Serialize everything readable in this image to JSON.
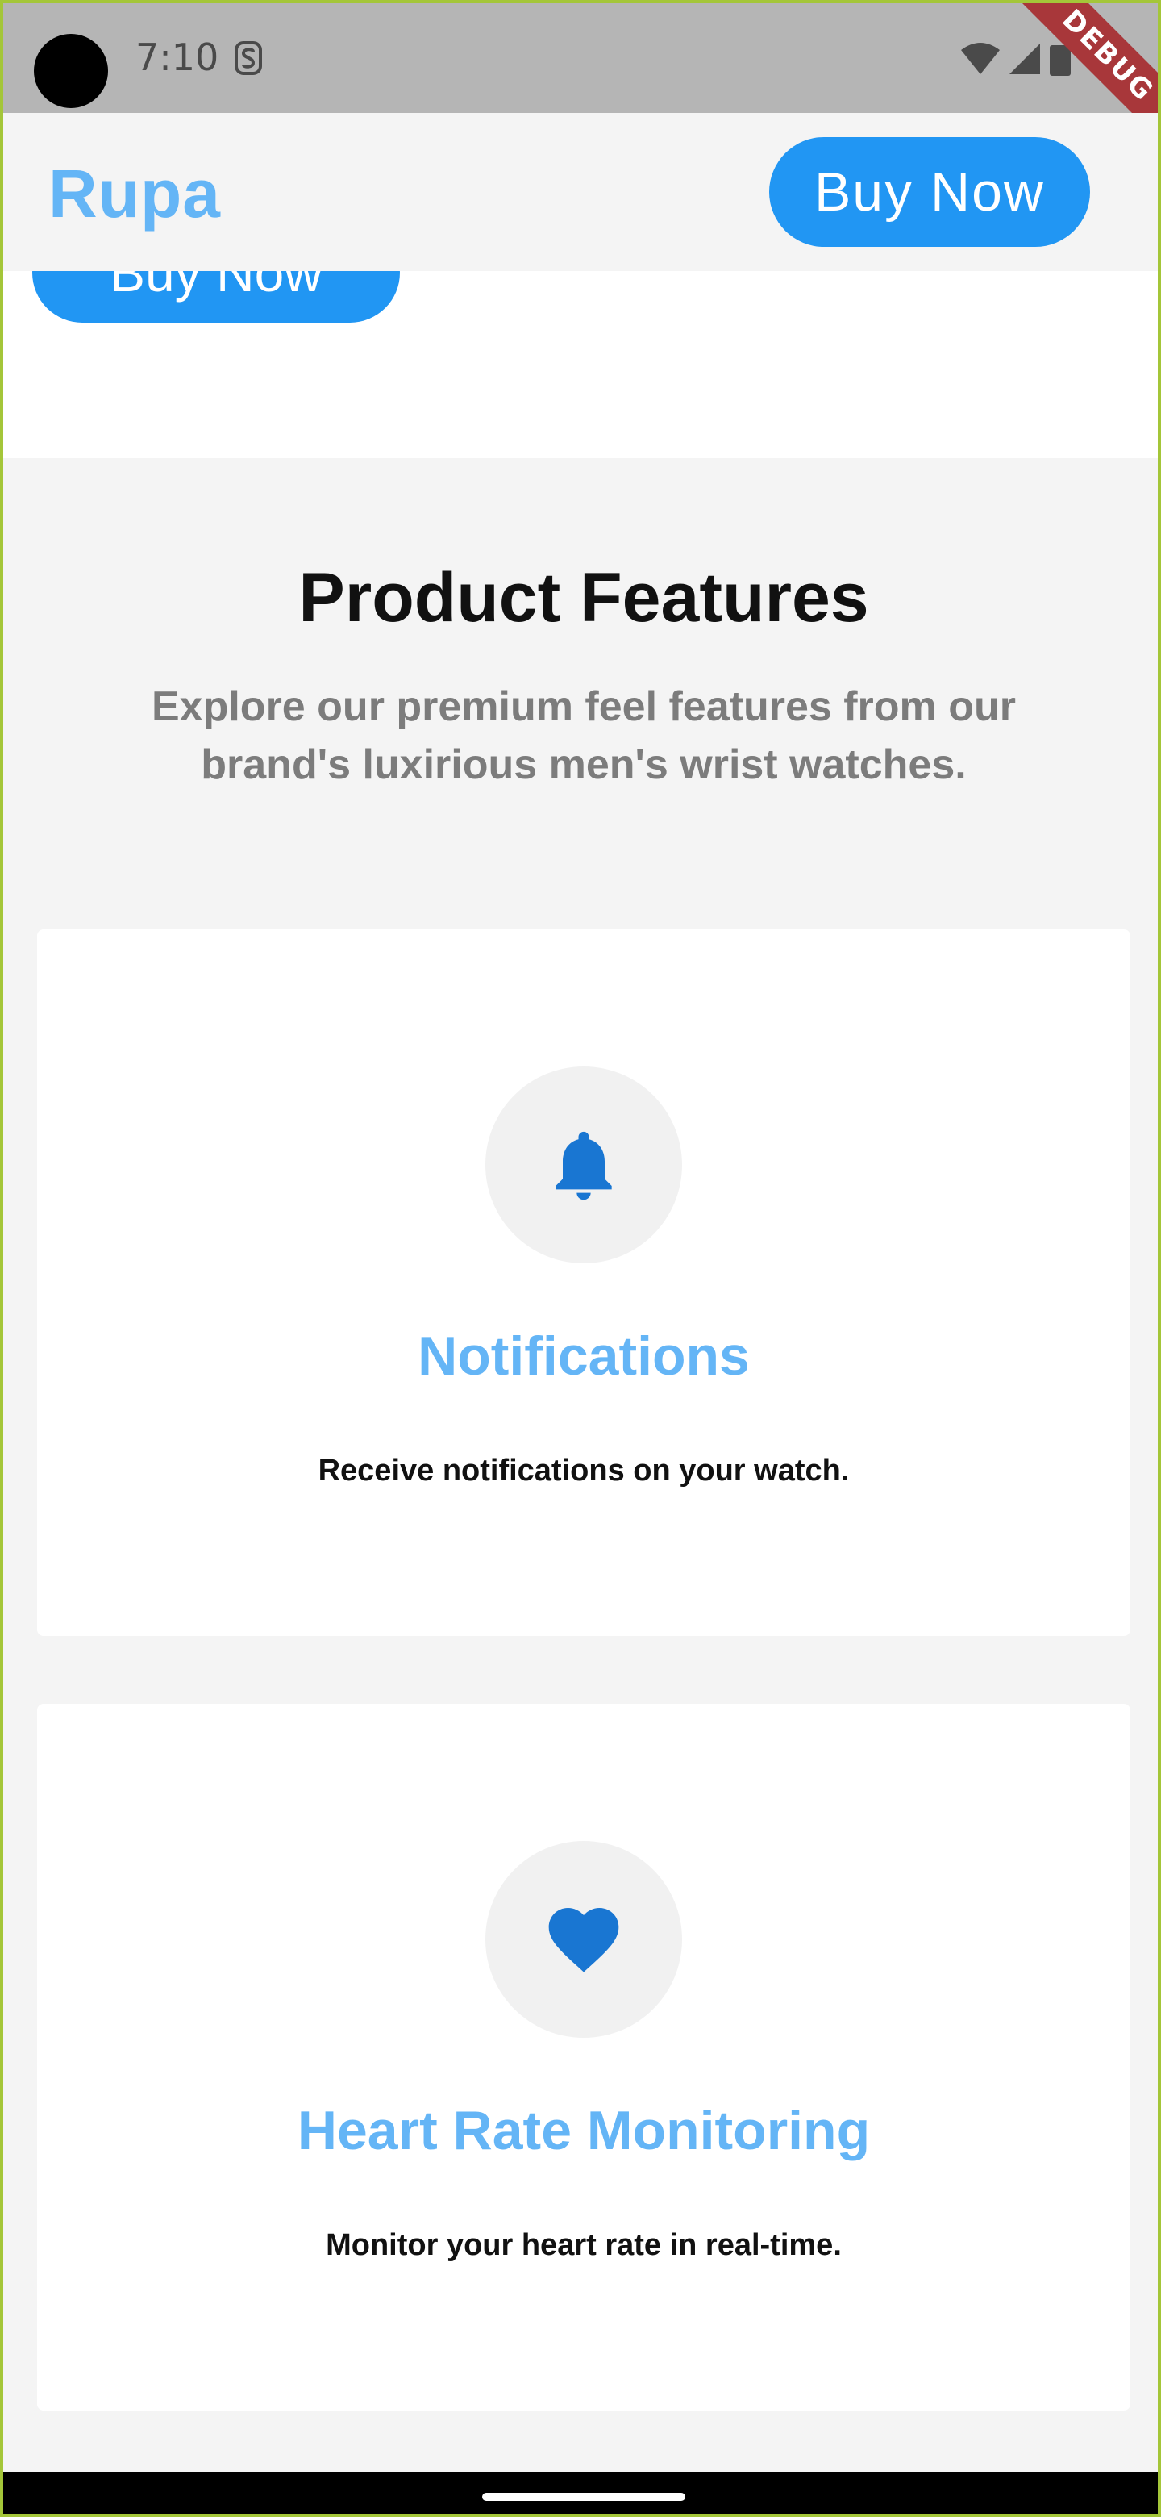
{
  "status_bar": {
    "time": "7:10",
    "debug_label": "DEBUG"
  },
  "app_bar": {
    "brand": "Rupa",
    "buy_button": "Buy Now"
  },
  "hero": {
    "button_label": "Buy Now"
  },
  "features": {
    "title": "Product Features",
    "subtitle": "Explore our premium feel features from our brand's luxirious men's wrist watches.",
    "cards": [
      {
        "icon": "bell-icon",
        "title": "Notifications",
        "description": "Receive notifications on your watch."
      },
      {
        "icon": "heart-icon",
        "title": "Heart Rate Monitoring",
        "description": "Monitor your heart rate in real-time."
      }
    ]
  },
  "colors": {
    "accent": "#2196f3",
    "brand_light": "#64b5f6",
    "icon_blue": "#1976d2",
    "section_bg": "#f4f4f4",
    "debug_ribbon": "#a8373a"
  }
}
